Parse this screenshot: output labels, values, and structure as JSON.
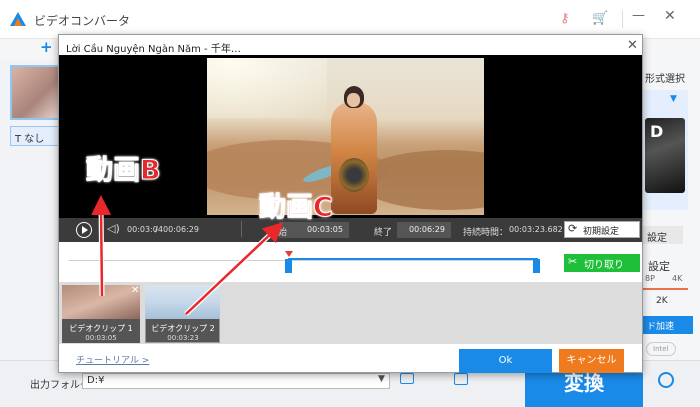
{
  "app": {
    "title": "ビデオコンバータ",
    "side_chip": "なし",
    "format_select": "形式選択",
    "format_thumb_text": "D",
    "init_label": "設定",
    "setting_label": "設定",
    "res_labels": [
      "8P",
      "4K",
      "2K"
    ],
    "hw_label": "ド加速",
    "intel_label": "Intel",
    "output_folder_label": "出力フォルダ：",
    "output_folder_value": "D:¥",
    "convert_label": "変換"
  },
  "modal": {
    "title": "Lời Cầu Nguyện Ngàn Năm - 千年…",
    "player": {
      "current_time": "00:03:04",
      "separator": "/",
      "total_time": "00:06:29"
    },
    "start_label": "開始",
    "start_value": "00:03:05",
    "end_label": "終了",
    "end_value": "00:06:29",
    "duration_label": "持続時間：",
    "duration_value": "00:03:23.682",
    "reset_label": "初期設定",
    "cut_label": "切り取り",
    "clips": [
      {
        "name": "ビデオクリップ 1",
        "time": "00:03:05"
      },
      {
        "name": "ビデオクリップ 2",
        "time": "00:03:23"
      }
    ],
    "tutorial_label": "チュートリアル >",
    "ok_label": "Ok",
    "cancel_label": "キャンセル"
  },
  "annotations": {
    "label_b": "動画B",
    "label_c": "動画C",
    "color": "#e8282b"
  },
  "colors": {
    "accent": "#1a8ae8",
    "cut_green": "#1fbf3a",
    "cancel_orange": "#f07a1e"
  }
}
